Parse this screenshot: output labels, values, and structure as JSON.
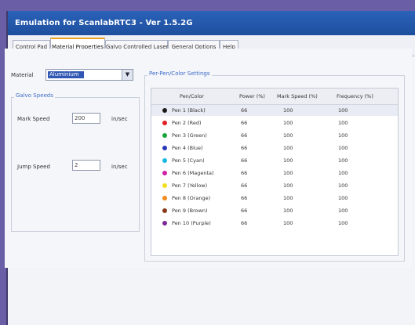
{
  "window": {
    "title": "Emulation for ScanlabRTC3 - Ver 1.5.2G"
  },
  "tabs": [
    {
      "label": "Control Pad"
    },
    {
      "label": "Material Properties"
    },
    {
      "label": "Galvo Controlled Laser"
    },
    {
      "label": "General Options"
    },
    {
      "label": "Help"
    }
  ],
  "material": {
    "label": "Material",
    "value": "Aluminium"
  },
  "galvo_speeds": {
    "title": "Galvo Speeds",
    "mark_speed_label": "Mark Speed",
    "mark_speed_value": "200",
    "jump_speed_label": "Jump Speed",
    "jump_speed_value": "2",
    "unit": "in/sec"
  },
  "pen_settings": {
    "title": "Per-Pen/Color Settings",
    "columns": [
      "Pen/Color",
      "Power (%)",
      "Mark Speed (%)",
      "Frequency (%)"
    ],
    "rows": [
      {
        "name": "Pen 1 (Black)",
        "power": "66",
        "mark_speed": "100",
        "frequency": "100",
        "color": "#1a1a1a"
      },
      {
        "name": "Pen 2 (Red)",
        "power": "66",
        "mark_speed": "100",
        "frequency": "100",
        "color": "#e02020"
      },
      {
        "name": "Pen 3 (Green)",
        "power": "66",
        "mark_speed": "100",
        "frequency": "100",
        "color": "#1aa33a"
      },
      {
        "name": "Pen 4 (Blue)",
        "power": "66",
        "mark_speed": "100",
        "frequency": "100",
        "color": "#2838b8"
      },
      {
        "name": "Pen 5 (Cyan)",
        "power": "66",
        "mark_speed": "100",
        "frequency": "100",
        "color": "#18b8e6"
      },
      {
        "name": "Pen 6 (Magenta)",
        "power": "66",
        "mark_speed": "100",
        "frequency": "100",
        "color": "#d020a8"
      },
      {
        "name": "Pen 7 (Yellow)",
        "power": "66",
        "mark_speed": "100",
        "frequency": "100",
        "color": "#f2e020"
      },
      {
        "name": "Pen 8 (Orange)",
        "power": "66",
        "mark_speed": "100",
        "frequency": "100",
        "color": "#f08a18"
      },
      {
        "name": "Pen 9 (Brown)",
        "power": "66",
        "mark_speed": "100",
        "frequency": "100",
        "color": "#8a3a18"
      },
      {
        "name": "Pen 10 (Purple)",
        "power": "66",
        "mark_speed": "100",
        "frequency": "100",
        "color": "#7a2a9a"
      }
    ]
  }
}
